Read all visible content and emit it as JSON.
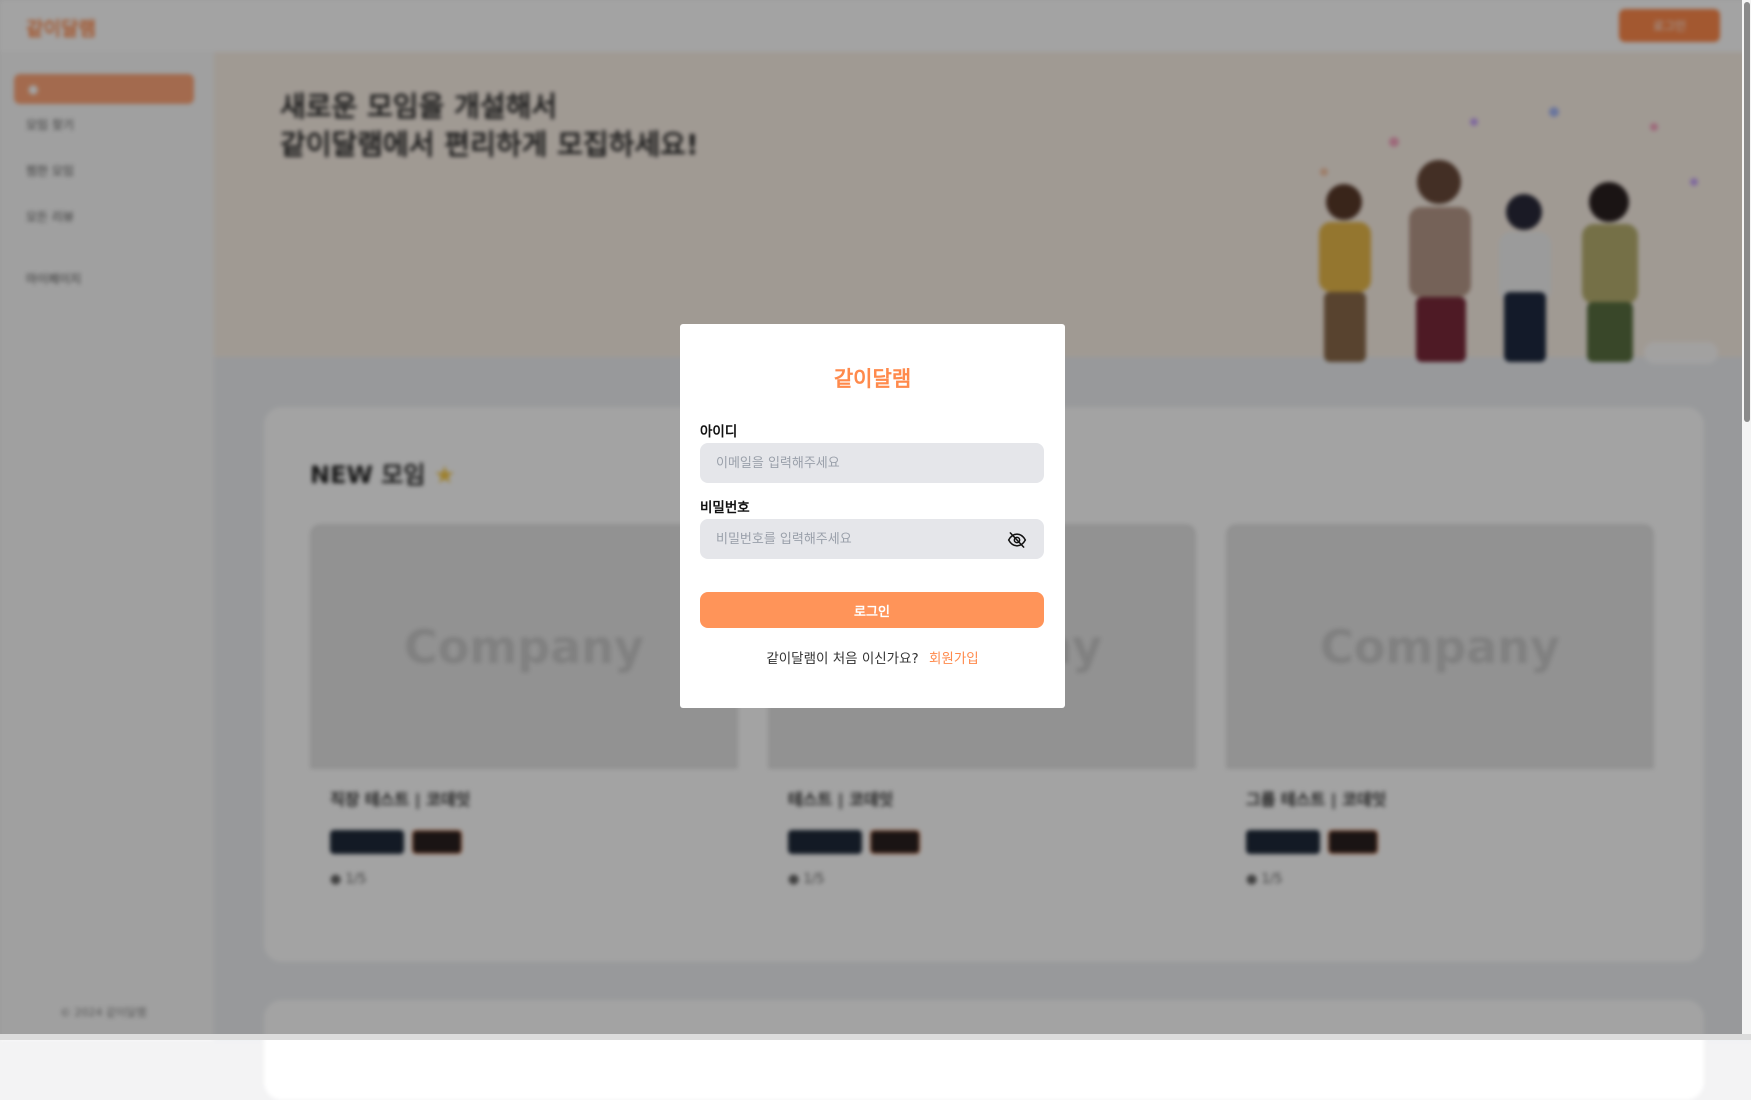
{
  "header": {
    "logo": "같이달램",
    "login_label": "로그인"
  },
  "sidebar": {
    "items": [
      "모임 찾기",
      "찜한 모임",
      "모든 리뷰",
      "마이페이지"
    ],
    "footer": "© 2024 같이달램"
  },
  "banner": {
    "title": "새로운 모임을 개설해서\n같이달램에서 편리하게 모집하세요!"
  },
  "section": {
    "title": "NEW 모임",
    "cards": [
      {
        "thumb": "Company",
        "title": "직장 테스트 | 코데잇",
        "count": "1/5"
      },
      {
        "thumb": "Company",
        "title": "테스트 | 코데잇",
        "count": "1/5"
      },
      {
        "thumb": "Company",
        "title": "그룹 테스트 | 코데잇",
        "count": "1/5"
      }
    ]
  },
  "modal": {
    "title": "같이달램",
    "id_label": "아이디",
    "id_placeholder": "이메일을 입력해주세요",
    "pw_label": "비밀번호",
    "pw_placeholder": "비밀번호를 입력해주세요",
    "submit_label": "로그인",
    "footer_text": "같이달램이 처음 이신가요?",
    "signup_label": "회원가입"
  },
  "colors": {
    "accent": "#ff8a4c",
    "button": "#ff9459",
    "input_bg": "#e5e6ea"
  },
  "icons": {
    "password_toggle": "eye-off-icon"
  }
}
